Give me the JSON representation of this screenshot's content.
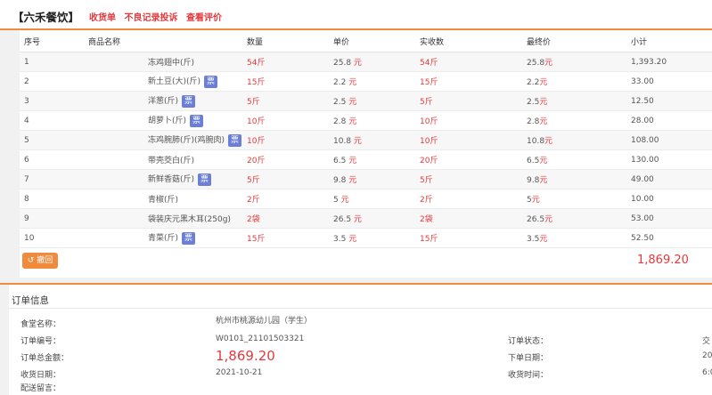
{
  "header": {
    "brand": "【六禾餐饮】",
    "links": [
      "收货单",
      "不良记录投诉",
      "查看评价"
    ]
  },
  "table": {
    "columns": [
      "序号",
      "商品名称",
      "数量",
      "单价",
      "实收数",
      "最终价",
      "小计"
    ],
    "rows": [
      {
        "no": "1",
        "name": "冻鸡翅中(斤)",
        "ticket": false,
        "qty": "54",
        "qty_unit": "斤",
        "price": "25.8",
        "price_unit": "元",
        "recv": "54",
        "recv_unit": "斤",
        "final": "25.8",
        "final_unit": "元",
        "subtotal": "1,393.20"
      },
      {
        "no": "2",
        "name": "新土豆(大)(斤)",
        "ticket": true,
        "qty": "15",
        "qty_unit": "斤",
        "price": "2.2",
        "price_unit": "元",
        "recv": "15",
        "recv_unit": "斤",
        "final": "2.2",
        "final_unit": "元",
        "subtotal": "33.00"
      },
      {
        "no": "3",
        "name": "洋葱(斤)",
        "ticket": true,
        "qty": "5",
        "qty_unit": "斤",
        "price": "2.5",
        "price_unit": "元",
        "recv": "5",
        "recv_unit": "斤",
        "final": "2.5",
        "final_unit": "元",
        "subtotal": "12.50"
      },
      {
        "no": "4",
        "name": "胡萝卜(斤)",
        "ticket": true,
        "qty": "10",
        "qty_unit": "斤",
        "price": "2.8",
        "price_unit": "元",
        "recv": "10",
        "recv_unit": "斤",
        "final": "2.8",
        "final_unit": "元",
        "subtotal": "28.00"
      },
      {
        "no": "5",
        "name": "冻鸡腕肺(斤)(鸡腕肉)",
        "ticket": true,
        "qty": "10",
        "qty_unit": "斤",
        "price": "10.8",
        "price_unit": "元",
        "recv": "10",
        "recv_unit": "斤",
        "final": "10.8",
        "final_unit": "元",
        "subtotal": "108.00"
      },
      {
        "no": "6",
        "name": "带壳茭白(斤)",
        "ticket": false,
        "qty": "20",
        "qty_unit": "斤",
        "price": "6.5",
        "price_unit": "元",
        "recv": "20",
        "recv_unit": "斤",
        "final": "6.5",
        "final_unit": "元",
        "subtotal": "130.00"
      },
      {
        "no": "7",
        "name": "新鲜香菇(斤)",
        "ticket": true,
        "qty": "5",
        "qty_unit": "斤",
        "price": "9.8",
        "price_unit": "元",
        "recv": "5",
        "recv_unit": "斤",
        "final": "9.8",
        "final_unit": "元",
        "subtotal": "49.00"
      },
      {
        "no": "8",
        "name": "青椒(斤)",
        "ticket": false,
        "qty": "2",
        "qty_unit": "斤",
        "price": "5",
        "price_unit": "元",
        "recv": "2",
        "recv_unit": "斤",
        "final": "5",
        "final_unit": "元",
        "subtotal": "10.00"
      },
      {
        "no": "9",
        "name": "袋装庆元黑木耳(250g)",
        "ticket": false,
        "qty": "2",
        "qty_unit": "袋",
        "price": "26.5",
        "price_unit": "元",
        "recv": "2",
        "recv_unit": "袋",
        "final": "26.5",
        "final_unit": "元",
        "subtotal": "53.00"
      },
      {
        "no": "10",
        "name": "青菜(斤)",
        "ticket": true,
        "qty": "15",
        "qty_unit": "斤",
        "price": "3.5",
        "price_unit": "元",
        "recv": "15",
        "recv_unit": "斤",
        "final": "3.5",
        "final_unit": "元",
        "subtotal": "52.50"
      }
    ],
    "ticket_label": "票",
    "revoke_label": "撤回",
    "total": "1,869.20"
  },
  "order": {
    "title": "订单信息",
    "canteen_label": "食堂名称：",
    "canteen_value": "杭州市桃源幼儿园（学生）",
    "order_no_label": "订单编号：",
    "order_no_value": "W0101_21101503321",
    "status_label": "订单状态：",
    "status_value": "交",
    "amount_label": "订单总金额：",
    "amount_value": "1,869.20",
    "order_date_label": "下单日期：",
    "order_date_value": "20",
    "recv_date_label": "收货日期：",
    "recv_date_value": "2021-10-21",
    "recv_time_label": "收货时间：",
    "recv_time_value": "6:0",
    "note_label": "配送留言："
  },
  "colors": {
    "accent": "#f08a3c",
    "red": "#e4393c",
    "ticket": "#6b7fd7"
  }
}
